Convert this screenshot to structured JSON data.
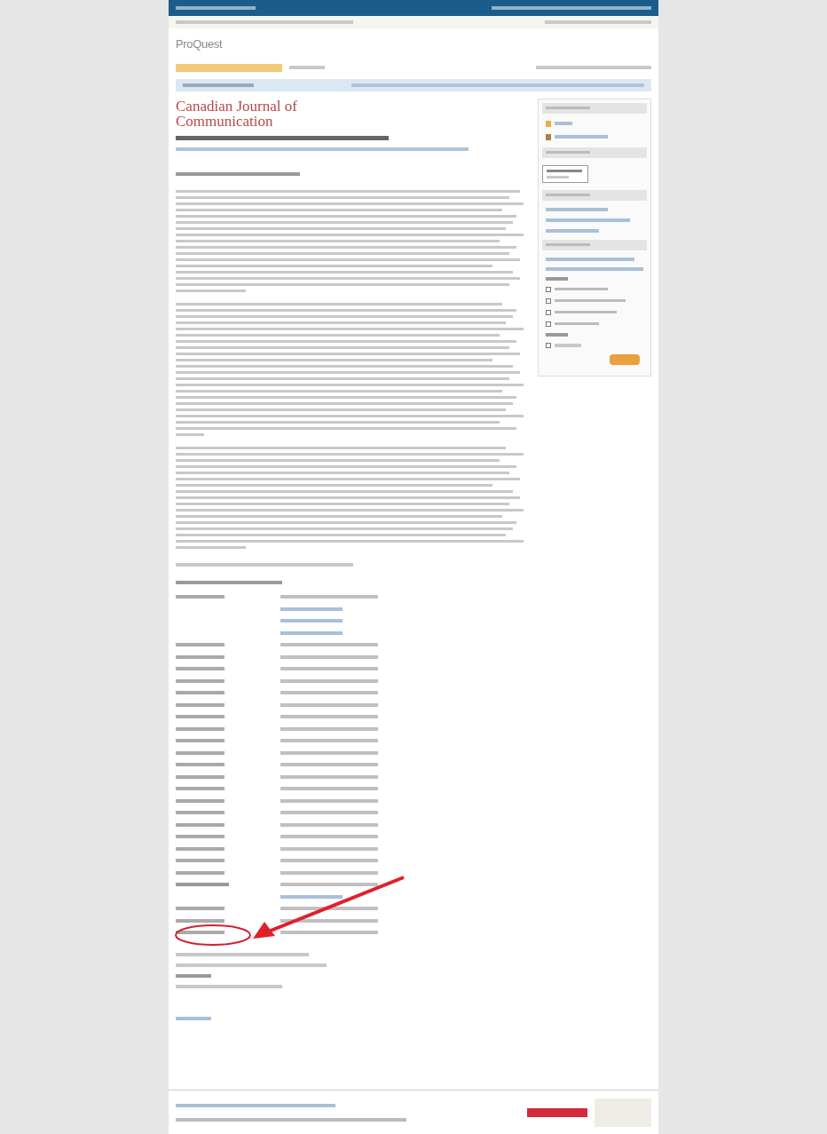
{
  "logo": "ProQuest",
  "journal_title": "Canadian Journal of Communication",
  "paragraphs": [
    {
      "kind": "long"
    },
    {
      "kind": "long"
    },
    {
      "kind": "long"
    }
  ],
  "sidebar_boxes": [
    {
      "kind": "icons"
    },
    {
      "kind": "field"
    },
    {
      "kind": "links"
    },
    {
      "kind": "checks",
      "options": [
        {
          "checked": false
        },
        {
          "checked": false
        },
        {
          "checked": false
        },
        {
          "checked": false
        },
        {
          "checked": false
        }
      ]
    }
  ],
  "details_rows": [
    {
      "kind": "label"
    },
    {
      "kind": "continued"
    },
    {
      "kind": "continued"
    },
    {
      "kind": "continued"
    },
    {
      "kind": "label"
    },
    {
      "kind": "label"
    },
    {
      "kind": "label"
    },
    {
      "kind": "label"
    },
    {
      "kind": "label"
    },
    {
      "kind": "label"
    },
    {
      "kind": "label"
    },
    {
      "kind": "label"
    },
    {
      "kind": "label"
    },
    {
      "kind": "label"
    },
    {
      "kind": "label"
    },
    {
      "kind": "label"
    },
    {
      "kind": "label"
    },
    {
      "kind": "label"
    },
    {
      "kind": "label"
    },
    {
      "kind": "label"
    },
    {
      "kind": "label"
    },
    {
      "kind": "label"
    },
    {
      "kind": "label"
    },
    {
      "kind": "label"
    },
    {
      "kind": "marked"
    },
    {
      "kind": "continued"
    },
    {
      "kind": "label"
    },
    {
      "kind": "label"
    },
    {
      "kind": "label"
    }
  ],
  "annotation": {
    "kind": "arrow"
  }
}
